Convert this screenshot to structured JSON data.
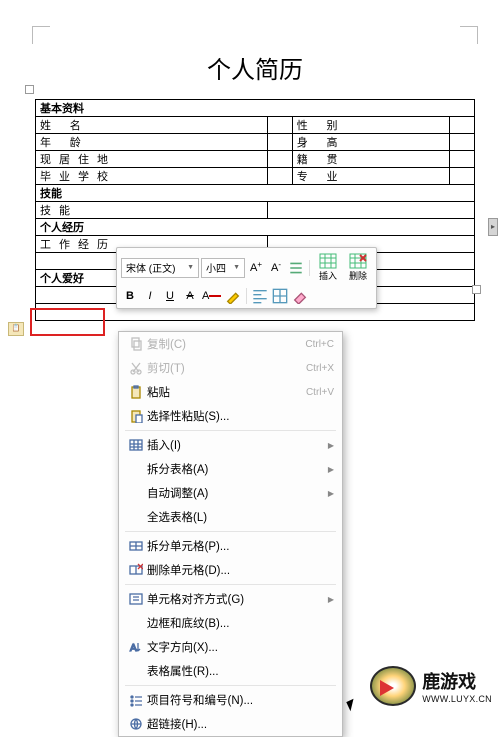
{
  "doc_title": "个人简历",
  "sections": {
    "basic": "基本资料",
    "skills": "技能",
    "skill_row": "技能",
    "exp": "个人经历",
    "work": "工作经历",
    "hobby": "个人爱好"
  },
  "fields": {
    "name": "姓  名",
    "gender": "性    别",
    "age": "年  龄",
    "height": "身    高",
    "addr": "现居住地",
    "native": "籍    贯",
    "school": "毕业学校",
    "major": "专    业"
  },
  "mini": {
    "font_name": "宋体 (正文)",
    "font_size": "小四",
    "insert": "插入",
    "delete": "删除"
  },
  "menu": {
    "copy": "复制(C)",
    "copy_sc": "Ctrl+C",
    "cut": "剪切(T)",
    "cut_sc": "Ctrl+X",
    "paste": "粘贴",
    "paste_sc": "Ctrl+V",
    "paste_sp": "选择性粘贴(S)...",
    "insert": "插入(I)",
    "split_tbl": "拆分表格(A)",
    "autofit": "自动调整(A)",
    "select_tbl": "全选表格(L)",
    "split_cell": "拆分单元格(P)...",
    "del_cell": "删除单元格(D)...",
    "align": "单元格对齐方式(G)",
    "border": "边框和底纹(B)...",
    "textdir": "文字方向(X)...",
    "tblprop": "表格属性(R)...",
    "bullets": "项目符号和编号(N)...",
    "link": "超链接(H)..."
  },
  "watermark": {
    "cn": "鹿游戏",
    "url": "WWW.LUYX.CN"
  }
}
